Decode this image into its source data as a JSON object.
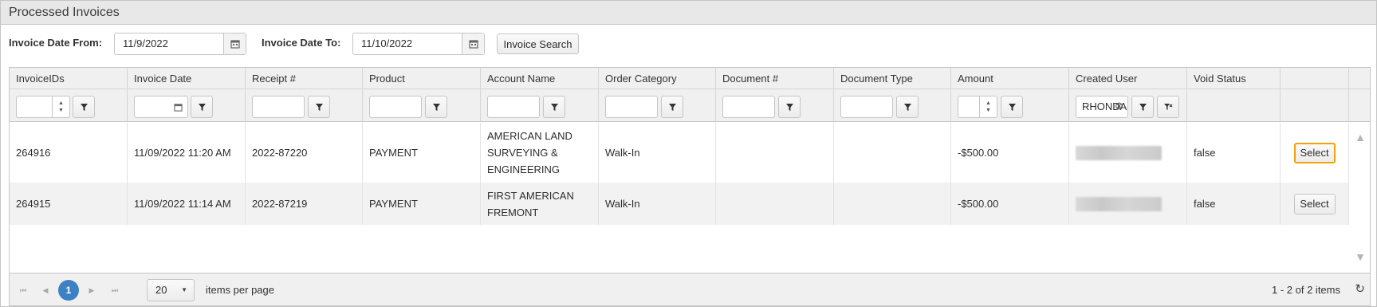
{
  "panel": {
    "title": "Processed Invoices"
  },
  "filters": {
    "date_from_label": "Invoice Date From:",
    "date_from_value": "11/9/2022",
    "date_to_label": "Invoice Date To:",
    "date_to_value": "11/10/2022",
    "search_button": "Invoice Search"
  },
  "grid": {
    "columns": [
      "InvoiceIDs",
      "Invoice Date",
      "Receipt #",
      "Product",
      "Account Name",
      "Order Category",
      "Document #",
      "Document Type",
      "Amount",
      "Created User",
      "Void Status",
      ""
    ],
    "created_user_filter": "RHONDA",
    "rows": [
      {
        "invoice_id": "264916",
        "invoice_date": "11/09/2022 11:20 AM",
        "receipt": "2022-87220",
        "product": "PAYMENT",
        "account_line1": "AMERICAN LAND",
        "account_line2": "SURVEYING &",
        "account_line3": "ENGINEERING",
        "order_category": "Walk-In",
        "document_no": "",
        "document_type": "",
        "amount": "-$500.00",
        "void_status": "false",
        "select_label": "Select"
      },
      {
        "invoice_id": "264915",
        "invoice_date": "11/09/2022 11:14 AM",
        "receipt": "2022-87219",
        "product": "PAYMENT",
        "account_line1": "FIRST AMERICAN",
        "account_line2": "FREMONT",
        "order_category": "Walk-In",
        "document_no": "",
        "document_type": "",
        "amount": "-$500.00",
        "void_status": "false",
        "select_label": "Select"
      }
    ]
  },
  "pager": {
    "current_page": "1",
    "page_size": "20",
    "items_per_page_label": "items per page",
    "summary": "1 - 2 of 2 items"
  },
  "colors": {
    "accent": "#3e80c4",
    "focus_outline": "#f0a30a",
    "header_bg": "#f0f0f0"
  }
}
